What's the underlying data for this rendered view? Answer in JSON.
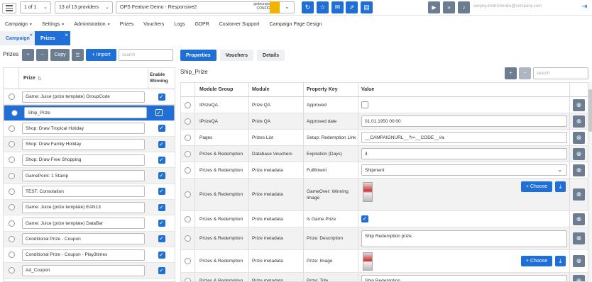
{
  "topbar": {
    "page_select": "1 of 1",
    "provider_select": "13 of 13 providers",
    "campaign_select": "OPS Feature Demo - Responsive2",
    "logo_text_1": "gmteurope",
    "logo_text_2": "CONFIG",
    "logo_badge": "",
    "email": "sergey.dmitrichenko@company.com"
  },
  "menu": {
    "items": [
      {
        "label": "Campaign",
        "dropdown": true
      },
      {
        "label": "Settings",
        "dropdown": true
      },
      {
        "label": "Administration",
        "dropdown": true
      },
      {
        "label": "Prizes",
        "dropdown": false
      },
      {
        "label": "Vouchers",
        "dropdown": false
      },
      {
        "label": "Logs",
        "dropdown": false
      },
      {
        "label": "GDPR",
        "dropdown": false
      },
      {
        "label": "Customer Support",
        "dropdown": false
      },
      {
        "label": "Campaign Page Design",
        "dropdown": false
      }
    ]
  },
  "tabs": [
    {
      "label": "Campaign"
    },
    {
      "label": "Prizes"
    }
  ],
  "left": {
    "title": "Prizes",
    "copy_label": "Copy",
    "import_label": "Import",
    "search_placeholder": "search",
    "col_prize": "Prize",
    "col_enable_1": "Enable",
    "col_enable_2": "Winning",
    "rows": [
      {
        "name": "Game: Juice (prize template) GroupCode",
        "checked": true
      },
      {
        "name": "Ship_Prize",
        "checked": true,
        "selected": true
      },
      {
        "name": "Shop: Draw Tropical Holiday",
        "checked": true
      },
      {
        "name": "Shop: Draw Family Holiday",
        "checked": true
      },
      {
        "name": "Shop: Draw Free Shopping",
        "checked": true
      },
      {
        "name": "GamePoint: 1 Stamp",
        "checked": true
      },
      {
        "name": "TEST: Consolation",
        "checked": true
      },
      {
        "name": "Game: Juice (prize template) EAN13",
        "checked": true
      },
      {
        "name": "Game: Juice (prize template) DataBar",
        "checked": true
      },
      {
        "name": "Conditional Prize - Coupon",
        "checked": true
      },
      {
        "name": "Conditional Prize - Coupon - Play3times",
        "checked": true
      },
      {
        "name": "Ad_Coupon",
        "checked": true
      }
    ]
  },
  "right": {
    "tabs": [
      "Properties",
      "Vouchers",
      "Details"
    ],
    "title": "Ship_Prize",
    "search_placeholder": "search",
    "columns": [
      "Module Group",
      "Module",
      "Property Key",
      "Value"
    ],
    "choose_label": "Choose",
    "rows": [
      {
        "group": "IPrizeQA",
        "module": "Prize QA",
        "key": "Approved",
        "type": "checkbox",
        "value": ""
      },
      {
        "group": "IPrizeQA",
        "module": "Prize QA",
        "key": "Approved date",
        "type": "input",
        "value": "01.01.1950 00:00"
      },
      {
        "group": "Pages",
        "module": "Prizes List",
        "key": "Setup: Redemption Link",
        "type": "input",
        "value": "__CAMPAIGNURL__?r=__CODE__#a"
      },
      {
        "group": "Prizes & Redemption",
        "module": "Database Vouchers",
        "key": "Expiration (Days)",
        "type": "input",
        "value": "4"
      },
      {
        "group": "Prizes & Redemption",
        "module": "Prize metadata",
        "key": "Fulfilment",
        "type": "select",
        "value": "Shipment"
      },
      {
        "group": "Prizes & Redemption",
        "module": "Prize metadata",
        "key": "GameOver: Winning Image",
        "type": "image",
        "value": ""
      },
      {
        "group": "Prizes & Redemption",
        "module": "Prize metadata",
        "key": "Is Game Prize",
        "type": "checked",
        "value": ""
      },
      {
        "group": "Prizes & Redemption",
        "module": "Prize metadata",
        "key": "Prize: Description",
        "type": "textarea",
        "value": "Ship Redemption prize."
      },
      {
        "group": "Prizes & Redemption",
        "module": "Prize metadata",
        "key": "Prize: Image",
        "type": "image",
        "value": ""
      },
      {
        "group": "Prizes & Redemption",
        "module": "Prize metadata",
        "key": "Prize: Title",
        "type": "input",
        "value": "Ship Redemption"
      }
    ]
  }
}
